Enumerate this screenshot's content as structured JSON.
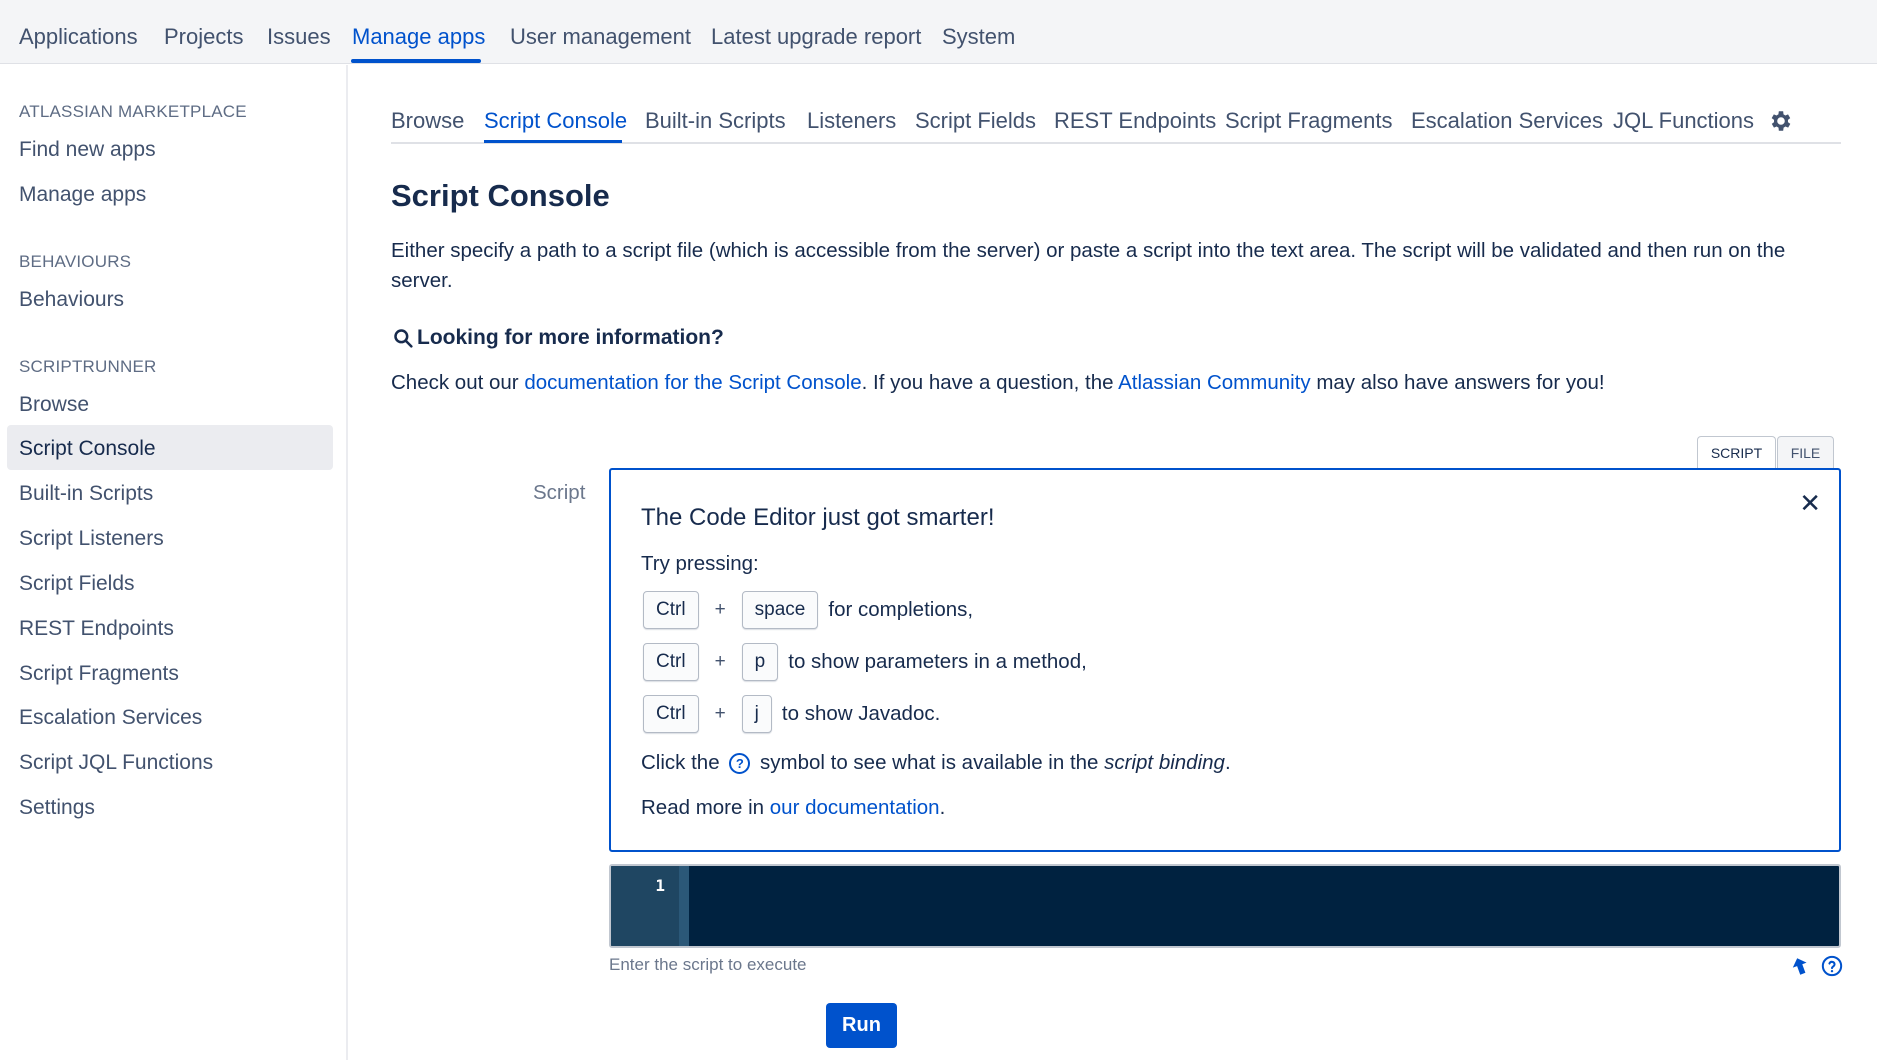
{
  "topnav": {
    "items": [
      "Applications",
      "Projects",
      "Issues",
      "Manage apps",
      "User management",
      "Latest upgrade report",
      "System"
    ],
    "active": "Manage apps"
  },
  "sidebar": {
    "sections": [
      {
        "heading": "ATLASSIAN MARKETPLACE",
        "links": [
          "Find new apps",
          "Manage apps"
        ]
      },
      {
        "heading": "BEHAVIOURS",
        "links": [
          "Behaviours"
        ]
      },
      {
        "heading": "SCRIPTRUNNER",
        "links": [
          "Browse",
          "Script Console",
          "Built-in Scripts",
          "Script Listeners",
          "Script Fields",
          "REST Endpoints",
          "Script Fragments",
          "Escalation Services",
          "Script JQL Functions",
          "Settings"
        ]
      }
    ],
    "active": "Script Console"
  },
  "tabs": {
    "items": [
      "Browse",
      "Script Console",
      "Built-in Scripts",
      "Listeners",
      "Script Fields",
      "REST Endpoints",
      "Script Fragments",
      "Escalation Services",
      "JQL Functions"
    ],
    "active": "Script Console",
    "settings_icon": "gear-icon"
  },
  "page": {
    "title": "Script Console",
    "description": "Either specify a path to a script file (which is accessible from the server) or paste a script into the text area. The script will be validated and then run on the server.",
    "info_heading": "Looking for more information?",
    "info_prefix": "Check out our ",
    "info_doc_link": "documentation for the Script Console",
    "info_middle": ". If you have a question, the ",
    "info_community_link": "Atlassian Community",
    "info_suffix": " may also have answers for you!"
  },
  "toggle": {
    "script": "SCRIPT",
    "file": "FILE",
    "active": "SCRIPT"
  },
  "field_label": "Script",
  "panel": {
    "title": "The Code Editor just got smarter!",
    "try_pressing": "Try pressing:",
    "shortcuts": [
      {
        "keys": [
          "Ctrl",
          "space"
        ],
        "plus": "+",
        "desc": "for completions,"
      },
      {
        "keys": [
          "Ctrl",
          "p"
        ],
        "plus": "+",
        "desc": "to show parameters in a method,"
      },
      {
        "keys": [
          "Ctrl",
          "j"
        ],
        "plus": "+",
        "desc": "to show Javadoc."
      }
    ],
    "click_prefix": "Click the ",
    "click_middle": " symbol to see what is available in the ",
    "click_emph": "script binding",
    "click_suffix": ".",
    "read_prefix": "Read more in ",
    "read_link": "our documentation",
    "read_suffix": ".",
    "close_symbol": "✕"
  },
  "editor": {
    "line_number": "1",
    "hint": "Enter the script to execute"
  },
  "run_button": "Run",
  "colors": {
    "accent": "#0052cc",
    "text": "#172b4d",
    "editor_bg": "#002240",
    "gutter_bg": "#1f4662"
  }
}
